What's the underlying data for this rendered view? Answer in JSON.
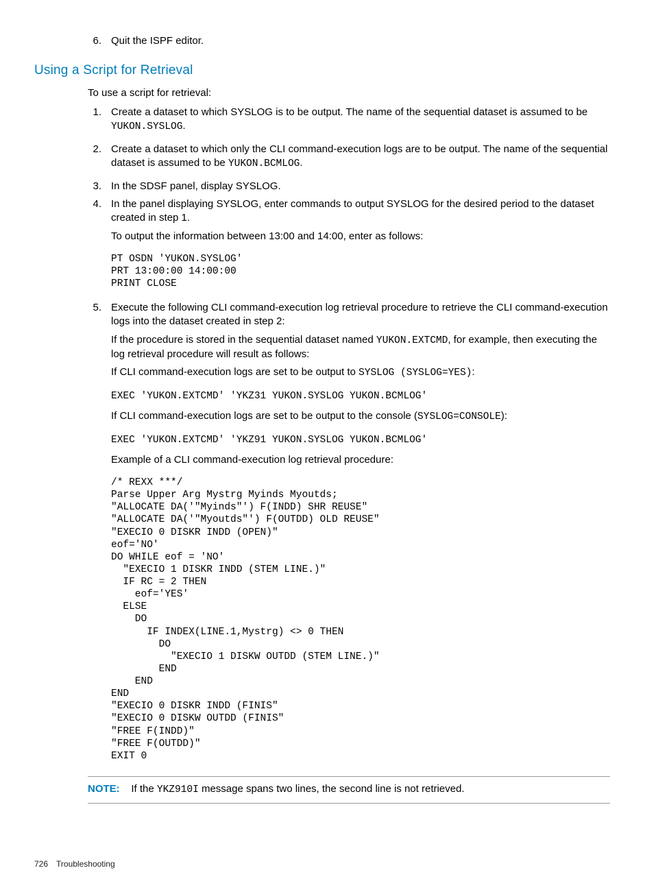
{
  "step6": {
    "num": "6.",
    "text": "Quit the ISPF editor."
  },
  "section_title": "Using a Script for Retrieval",
  "intro": "To use a script for retrieval:",
  "s1": {
    "num": "1.",
    "p1a": "Create a dataset to which SYSLOG is to be output. The name of the sequential dataset is assumed to be ",
    "code": "YUKON.SYSLOG",
    "p1b": "."
  },
  "s2": {
    "num": "2.",
    "p1a": "Create a dataset to which only the CLI command-execution logs are to be output. The name of the sequential dataset is assumed to be ",
    "code": "YUKON.BCMLOG",
    "p1b": "."
  },
  "s3": {
    "num": "3.",
    "text": "In the SDSF panel, display SYSLOG."
  },
  "s4": {
    "num": "4.",
    "p1": "In the panel displaying SYSLOG, enter commands to output SYSLOG for the desired period to the dataset created in step 1.",
    "p2": "To output the information between 13:00 and 14:00, enter as follows:",
    "code": "PT OSDN 'YUKON.SYSLOG'\nPRT 13:00:00 14:00:00\nPRINT CLOSE"
  },
  "s5": {
    "num": "5.",
    "p1": "Execute the following CLI command-execution log retrieval procedure to retrieve the CLI command-execution logs into the dataset created in step 2:",
    "p2a": "If the procedure is stored in the sequential dataset named ",
    "p2code": "YUKON.EXTCMD",
    "p2b": ", for example, then executing the log retrieval procedure will result as follows:",
    "p3a": "If CLI command-execution logs are set to be output to ",
    "p3code": "SYSLOG (SYSLOG=YES)",
    "p3b": ":",
    "code1": "EXEC 'YUKON.EXTCMD' 'YKZ31 YUKON.SYSLOG YUKON.BCMLOG'",
    "p4a": "If CLI command-execution logs are set to be output to the console (",
    "p4code": "SYSLOG=CONSOLE",
    "p4b": "):",
    "code2": "EXEC 'YUKON.EXTCMD' 'YKZ91 YUKON.SYSLOG YUKON.BCMLOG'",
    "p5": "Example of a CLI command-execution log retrieval procedure:",
    "code3": "/* REXX ***/\nParse Upper Arg Mystrg Myinds Myoutds;\n\"ALLOCATE DA('\"Myinds\"') F(INDD) SHR REUSE\"\n\"ALLOCATE DA('\"Myoutds\"') F(OUTDD) OLD REUSE\"\n\"EXECIO 0 DISKR INDD (OPEN)\"\neof='NO'\nDO WHILE eof = 'NO'\n  \"EXECIO 1 DISKR INDD (STEM LINE.)\"\n  IF RC = 2 THEN\n    eof='YES'\n  ELSE\n    DO\n      IF INDEX(LINE.1,Mystrg) <> 0 THEN\n        DO\n          \"EXECIO 1 DISKW OUTDD (STEM LINE.)\"\n        END\n    END\nEND\n\"EXECIO 0 DISKR INDD (FINIS\"\n\"EXECIO 0 DISKW OUTDD (FINIS\"\n\"FREE F(INDD)\"\n\"FREE F(OUTDD)\"\nEXIT 0"
  },
  "note": {
    "label": "NOTE:",
    "t1": "If the ",
    "code": "YKZ910I",
    "t2": " message spans two lines, the second line is not retrieved."
  },
  "footer": {
    "page": "726",
    "section": "Troubleshooting"
  }
}
